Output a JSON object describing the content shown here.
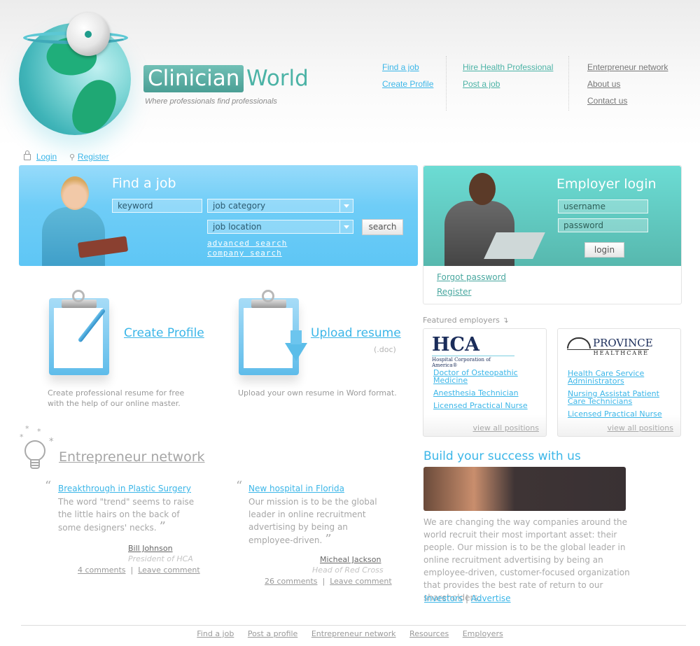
{
  "brand": {
    "name_part1": "Clinician",
    "name_part2": "World",
    "tagline": "Where professionals find professionals"
  },
  "top_nav": {
    "col1": [
      "Find a job",
      "Create Profile"
    ],
    "col2": [
      "Hire Health Professional",
      "Post a job"
    ],
    "col3": [
      "Enterpreneur network",
      "About us",
      "Contact us"
    ],
    "colors": {
      "col1": "#3bb6e8",
      "col2": "#4cb3a6",
      "col3": "#777777"
    }
  },
  "account_bar": {
    "login": "Login",
    "register": "Register"
  },
  "find_job": {
    "title": "Find a job",
    "keyword_placeholder": "keyword",
    "category_selected": "job category",
    "location_selected": "job location",
    "search_button": "search",
    "advanced_search": "advanced search",
    "company_search": "company search"
  },
  "employer_login": {
    "title": "Employer login",
    "username_placeholder": "username",
    "password_placeholder": "password",
    "login_button": "login",
    "forgot_password": "Forgot password",
    "register": "Register"
  },
  "features": [
    {
      "title": "Create Profile",
      "subtitle": "",
      "description": "Create professional resume for free with the help of our online master."
    },
    {
      "title": "Upload resume",
      "subtitle": "(.doc)",
      "description": "Upload your own resume in Word format."
    }
  ],
  "featured_employers": {
    "heading": "Featured employers",
    "employers": [
      {
        "logo_main": "HCA",
        "logo_sub": "Hospital Corporation of America®",
        "positions": [
          "Doctor of Osteopathic Medicine",
          "Anesthesia Technician",
          "Licensed Practical Nurse"
        ],
        "view_all": "view all positions"
      },
      {
        "logo_main": "PROVINCE",
        "logo_sub": "HEALTHCARE",
        "positions": [
          "Health Care Service Administrators",
          "Nursing Assistat Patient Care Technicians",
          "Licensed Practical Nurse"
        ],
        "view_all": "view all positions"
      }
    ]
  },
  "entrepreneur": {
    "heading": "Entrepreneur network",
    "posts": [
      {
        "title": "Breakthrough in Plastic Surgery",
        "body": "The word \"trend\" seems to raise the little hairs on the back of some designers' necks.",
        "author": "Bill Johnson",
        "role": "President of HCA",
        "comments": "4 comments",
        "leave_comment": "Leave comment"
      },
      {
        "title": "New hospital in Florida",
        "body": "Our mission is to be the global leader in online recruitment advertising by being an employee-driven.",
        "author": "Micheal Jackson",
        "role": "Head of Red Cross",
        "comments": "26 comments",
        "leave_comment": "Leave comment"
      }
    ]
  },
  "build": {
    "heading": "Build your success with us",
    "body": "We are changing the way companies around the world recruit their most important asset: their people. Our mission is to be the global leader in online recruitment advertising by being an employee-driven, customer-focused organization that provides the best rate of return to our shareholders.",
    "links": [
      "Investors",
      "Advertise"
    ],
    "separator": "|"
  },
  "footer_nav": [
    "Find a job",
    "Post a profile",
    "Entrepreneur network",
    "Resources",
    "Employers"
  ],
  "colors": {
    "accent_blue": "#3bb6e8",
    "accent_teal": "#4cb3a6",
    "find_job_panel": "#6fcdf7",
    "employer_panel": "#5fc8be"
  }
}
